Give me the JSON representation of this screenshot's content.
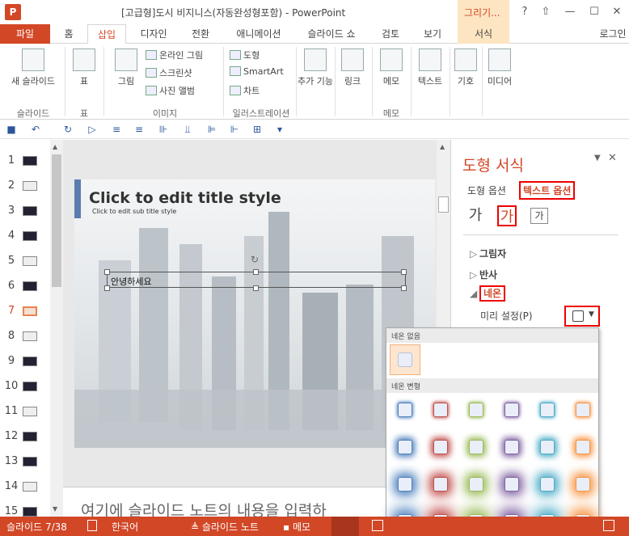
{
  "window": {
    "title": "[고급형]도시 비지니스(자동완성형포함) - PowerPoint",
    "app_icon_letter": "P",
    "context_tab_label": "그리기...",
    "controls": [
      "?",
      "⇧",
      "—",
      "☐",
      "✕"
    ]
  },
  "tabs": [
    "파일",
    "홈",
    "삽입",
    "디자인",
    "전환",
    "애니메이션",
    "슬라이드 쇼",
    "검토",
    "보기",
    "서식"
  ],
  "user": "로그인",
  "ribbon": {
    "groups": [
      {
        "name": "슬라이드",
        "buttons": [
          "새 슬라이드"
        ]
      },
      {
        "name": "표",
        "buttons": [
          "표"
        ]
      },
      {
        "name": "이미지",
        "buttons": [
          "그림",
          "온라인 그림",
          "스크린샷",
          "사진 앨범"
        ]
      },
      {
        "name": "일러스트레이션",
        "buttons": [
          "도형",
          "SmartArt",
          "차트"
        ]
      },
      {
        "name": "",
        "buttons": [
          "추가 기능"
        ]
      },
      {
        "name": "",
        "buttons": [
          "링크"
        ]
      },
      {
        "name": "메모",
        "buttons": [
          "메모"
        ]
      },
      {
        "name": "",
        "buttons": [
          "텍스트"
        ]
      },
      {
        "name": "",
        "buttons": [
          "기호"
        ]
      },
      {
        "name": "",
        "buttons": [
          "미디어"
        ]
      }
    ]
  },
  "thumbnails": [
    "1",
    "2",
    "3",
    "4",
    "5",
    "6",
    "7",
    "8",
    "9",
    "10",
    "11",
    "12",
    "13",
    "14",
    "15"
  ],
  "selected_slide": "7",
  "slide": {
    "title": "Click to edit title style",
    "subtitle": "Click to edit sub title style",
    "textbox": "안녕하세요"
  },
  "notes_placeholder": "여기에 슬라이드 노트의 내용을 입력하",
  "pane": {
    "title": "도형 서식",
    "tab_shape": "도형 옵션",
    "tab_text": "텍스트 옵션",
    "icons": [
      "가",
      "가",
      "가"
    ],
    "sections": [
      "그림자",
      "반사",
      "네온"
    ],
    "preset_label": "미리 설정(P)"
  },
  "gallery": {
    "none_header": "네온 없음",
    "variants_header": "네온 변형",
    "colors": [
      "#4f81bd",
      "#c0504d",
      "#9bbb59",
      "#8064a2",
      "#4bacc6",
      "#f79646"
    ]
  },
  "status": {
    "slide_info": "슬라이드 7/38",
    "language": "한국어",
    "notes": "슬라이드 노트",
    "comments": "메모"
  }
}
